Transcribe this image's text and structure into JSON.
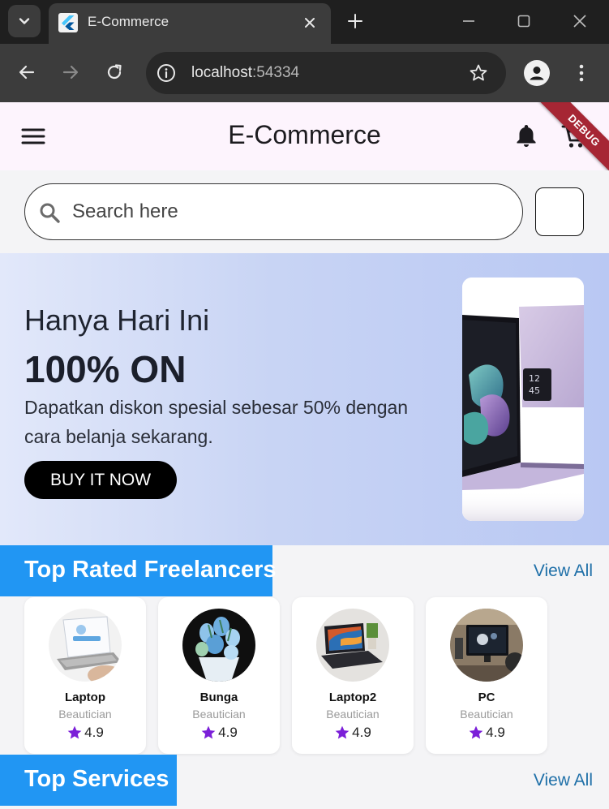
{
  "browser": {
    "tab_title": "E-Commerce",
    "url_host": "localhost",
    "url_port": ":54334"
  },
  "appbar": {
    "title": "E-Commerce",
    "debug_label": "DEBUG"
  },
  "search": {
    "placeholder": "Search here"
  },
  "banner": {
    "eyebrow": "Hanya Hari Ini",
    "headline": "100% ON",
    "description": "Dapatkan diskon spesial sebesar 50% dengan cara belanja sekarang.",
    "cta_label": "BUY IT NOW"
  },
  "top_rated": {
    "title": "Top Rated Freelancers",
    "view_all": "View All",
    "cards": [
      {
        "name": "Laptop",
        "role": "Beautician",
        "rating": "4.9"
      },
      {
        "name": "Bunga",
        "role": "Beautician",
        "rating": "4.9"
      },
      {
        "name": "Laptop2",
        "role": "Beautician",
        "rating": "4.9"
      },
      {
        "name": "PC",
        "role": "Beautician",
        "rating": "4.9"
      }
    ]
  },
  "top_services": {
    "title": "Top Services",
    "view_all": "View All"
  },
  "colors": {
    "section_header": "#2196f3",
    "star": "#7b1fd8",
    "debug_ribbon": "#a62634"
  }
}
